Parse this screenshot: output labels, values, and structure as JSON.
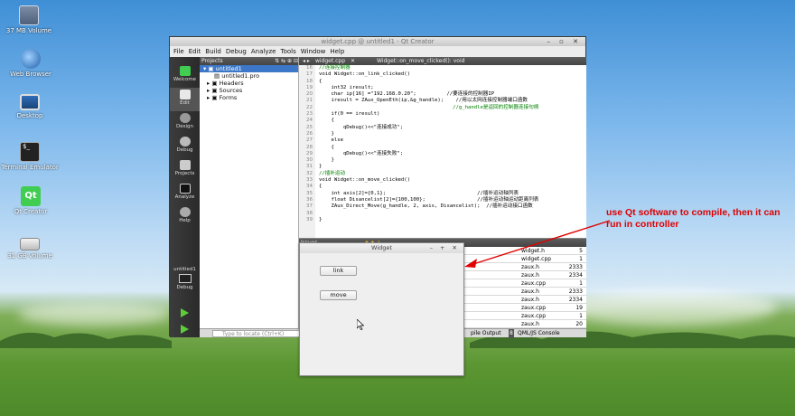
{
  "desktop": {
    "icons": [
      {
        "label": "37 MB Volume",
        "icon": "drive-icon"
      },
      {
        "label": "Web Browser",
        "icon": "globe-icon"
      },
      {
        "label": "Desktop",
        "icon": "monitor-icon"
      },
      {
        "label": "Terminal Emulator",
        "icon": "terminal-icon"
      },
      {
        "label": "Qt Creator",
        "icon": "qt-icon"
      },
      {
        "label": "31 GB Volume",
        "icon": "drive-icon"
      }
    ]
  },
  "qt": {
    "title": "widget.cpp @ untitled1 - Qt Creator",
    "menu": [
      "File",
      "Edit",
      "Build",
      "Debug",
      "Analyze",
      "Tools",
      "Window",
      "Help"
    ],
    "modes": [
      "Welcome",
      "Edit",
      "Design",
      "Debug",
      "Projects",
      "Analyze",
      "Help"
    ],
    "kit": {
      "project": "untitled1",
      "mode": "Debug"
    },
    "projects_header": "Projects",
    "tree": [
      "untitled1",
      "untitled1.pro",
      "Headers",
      "Sources",
      "Forms"
    ],
    "editor_tab": "widget.cpp",
    "editor_func": "Widget::on_move_clicked(): void",
    "line_numbers": [
      "16",
      "17",
      "18",
      "19",
      "20",
      "21",
      "22",
      "23",
      "24",
      "25",
      "26",
      "27",
      "28",
      "29",
      "30",
      "31",
      "32",
      "33",
      "34",
      "35",
      "36",
      "37",
      "38",
      "39"
    ],
    "code": [
      "//连接控制器",
      "void Widget::on_link_clicked()",
      "{",
      "    int32 iresult;",
      "    char ip[16] =\"192.168.0.20\";          //要连接的控制器IP",
      "    iresult = ZAux_OpenEth(ip,&g_handle);    //用以太网连接控制器端口函数",
      "                                            //g_handle是返回的控制器连接句柄",
      "    if(0 == iresult)",
      "    {",
      "        qDebug()<<\"连接成功\";",
      "    }",
      "    else",
      "    {",
      "        qDebug()<<\"连接失败\";",
      "    }",
      "}",
      "//插补运动",
      "void Widget::on_move_clicked()",
      "{",
      "    int axis[2]={0,1};                              //插补运动轴列表",
      "    float Disancelist[2]={100,100};                 //插补运动轴运动距离列表",
      "    ZAux_Direct_Move(g_handle, 2, axis, Disancelist);  //插补运动接口函数",
      "",
      "}"
    ],
    "issues_header": "Issues",
    "issues": [
      {
        "file": "widget.h",
        "line": "5"
      },
      {
        "file": "widget.cpp",
        "line": "1"
      },
      {
        "file": "zaux.h",
        "line": "2333"
      },
      {
        "file": "zaux.h",
        "line": "2334"
      },
      {
        "file": "zaux.cpp",
        "line": "1"
      },
      {
        "file": "zaux.h",
        "line": "2333"
      },
      {
        "file": "zaux.h",
        "line": "2334"
      },
      {
        "file": "zaux.cpp",
        "line": "19"
      },
      {
        "file": "zaux.cpp",
        "line": "1"
      },
      {
        "file": "zaux.h",
        "line": "20"
      }
    ],
    "status": {
      "locate_placeholder": "Type to locate (Ctrl+K)",
      "compile": "pile Output",
      "qml": "QML/JS Console",
      "qml_num": "8"
    }
  },
  "widget_window": {
    "title": "Widget",
    "link_label": "link",
    "move_label": "move"
  },
  "annotation": "use Qt software to compile, then it can run in controller",
  "colors": {
    "annotation": "#e00000",
    "accent": "#3d78c8"
  }
}
